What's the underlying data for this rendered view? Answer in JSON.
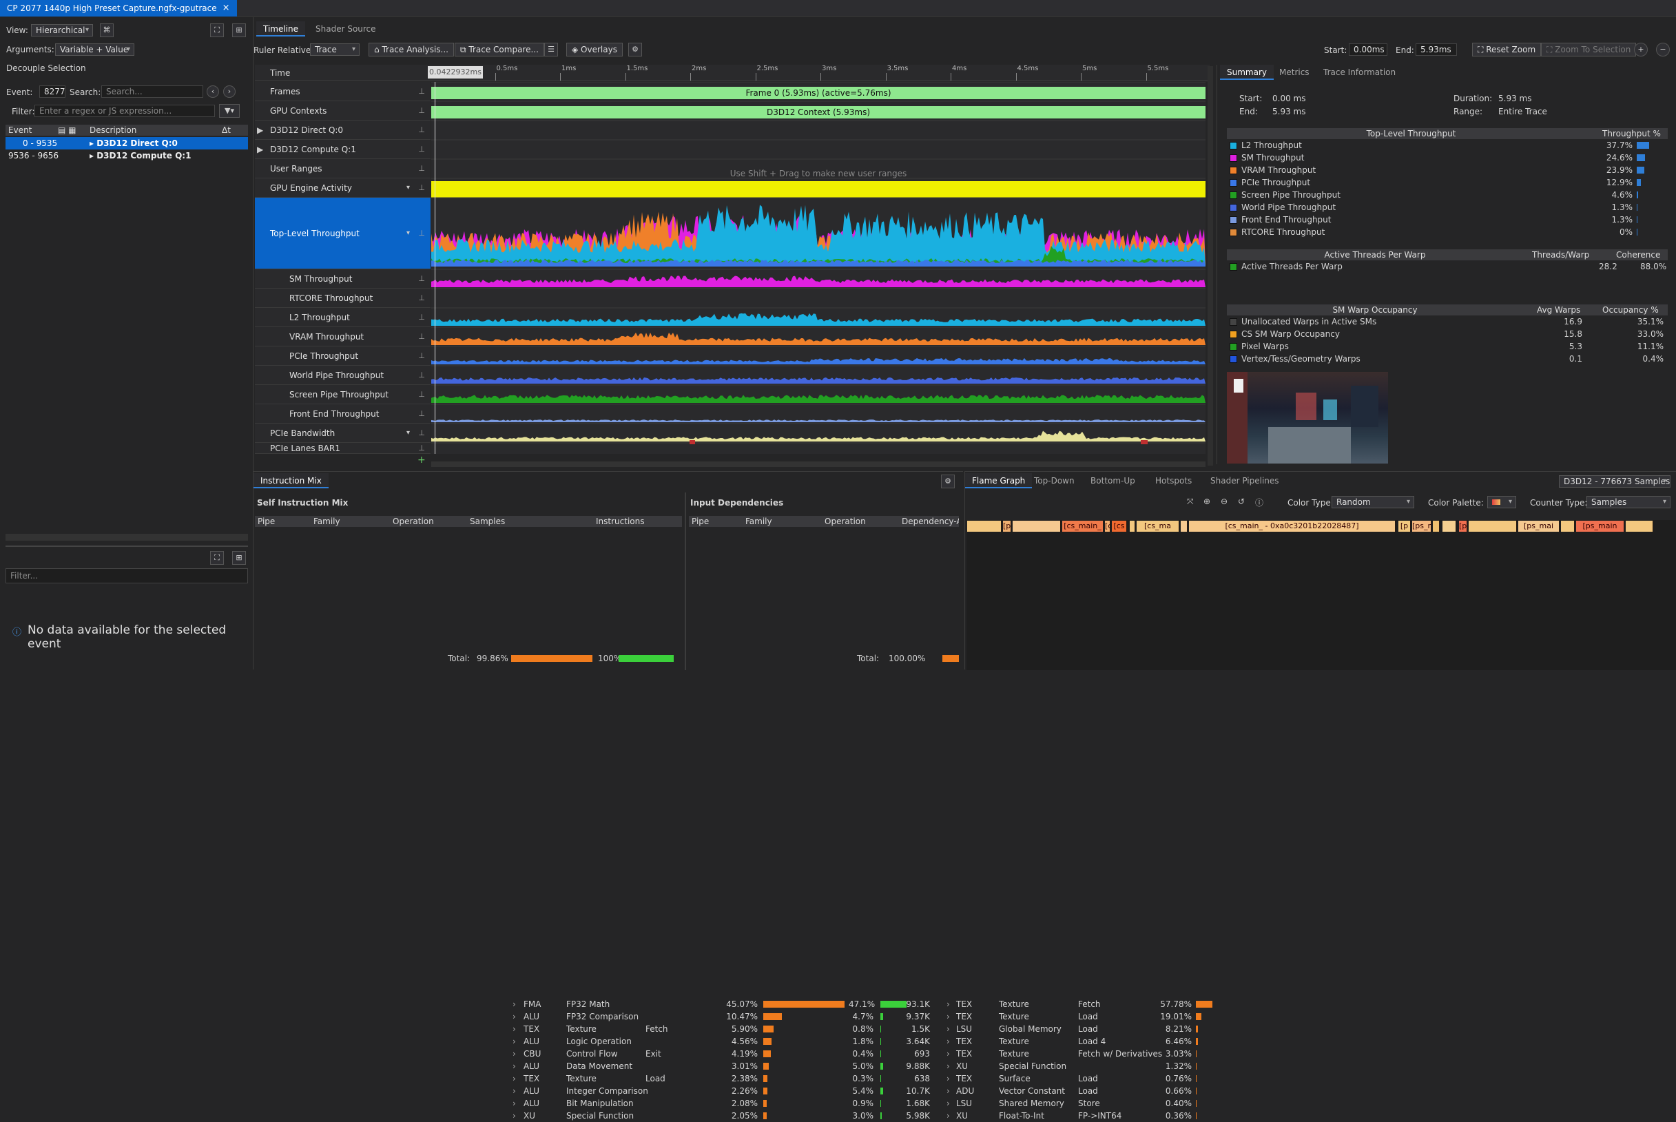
{
  "window": {
    "tab_title": "CP 2077 1440p High Preset Capture.ngfx-gputrace",
    "close": "×"
  },
  "colors": {
    "accent": "#0a64c8",
    "l2": "#1ab0e0",
    "sm": "#e020e0",
    "vram": "#f0802a",
    "pcie": "#3a78e8",
    "screen": "#22a022",
    "world": "#4466dd",
    "frontend": "#7a9adf",
    "rtcore": "#e08a3a",
    "frames": "#8ee88e",
    "activity": "#f0f000",
    "pcie_bw": "#e6e29a"
  },
  "left": {
    "view_label": "View:",
    "view_value": "Hierarchical",
    "args_label": "Arguments:",
    "args_value": "Variable + Value",
    "decouple": "Decouple Selection",
    "event_label": "Event:",
    "event_value": "8277",
    "search_label": "Search:",
    "search_placeholder": "Search...",
    "filter_label": "Filter:",
    "filter_placeholder": "Enter a regex or JS expression...",
    "cols": {
      "event": "Event",
      "desc": "Description",
      "dt": "Δt"
    },
    "rows": [
      {
        "range": "0 - 9535",
        "desc": "D3D12 Direct Q:0"
      },
      {
        "range": "9536 - 9656",
        "desc": "D3D12 Compute Q:1"
      }
    ],
    "filter2_placeholder": "Filter...",
    "nodata": "No data available for the selected event"
  },
  "timeline": {
    "tabs": [
      "Timeline",
      "Shader Source"
    ],
    "ruler_label": "Ruler Relative:",
    "ruler_value": "Trace",
    "trace_analysis": "Trace Analysis...",
    "trace_compare": "Trace Compare...",
    "overlays": "Overlays",
    "start_label": "Start:",
    "start_value": "0.00ms",
    "end_label": "End:",
    "end_value": "5.93ms",
    "reset_zoom": "Reset Zoom",
    "zoom_sel": "Zoom To Selection",
    "time_label": "Time",
    "cursor": "0.0422932ms",
    "ticks": [
      "0.5ms",
      "1ms",
      "1.5ms",
      "2ms",
      "2.5ms",
      "3ms",
      "3.5ms",
      "4ms",
      "4.5ms",
      "5ms",
      "5.5ms"
    ],
    "lanes": [
      "Frames",
      "GPU Contexts",
      "D3D12 Direct Q:0",
      "D3D12 Compute Q:1",
      "User Ranges",
      "GPU Engine Activity",
      "Top-Level Throughput",
      "SM Throughput",
      "RTCORE Throughput",
      "L2 Throughput",
      "VRAM Throughput",
      "PCIe Throughput",
      "World Pipe Throughput",
      "Screen Pipe Throughput",
      "Front End Throughput",
      "PCIe Bandwidth",
      "PCIe Lanes BAR1"
    ],
    "frame_bar": "Frame 0 (5.93ms) (active=5.76ms)",
    "context_bar": "D3D12 Context (5.93ms)",
    "user_hint": "Use Shift + Drag to make new user ranges"
  },
  "summary": {
    "tabs": [
      "Summary",
      "Metrics",
      "Trace Information"
    ],
    "start_l": "Start:",
    "start_v": "0.00 ms",
    "end_l": "End:",
    "end_v": "5.93 ms",
    "dur_l": "Duration:",
    "dur_v": "5.93 ms",
    "range_l": "Range:",
    "range_v": "Entire Trace",
    "tlt": {
      "h1": "Top-Level Throughput",
      "h2": "Throughput %",
      "rows": [
        {
          "n": "L2 Throughput",
          "v": "37.7%",
          "p": 37.7,
          "c": "#1ab0e0"
        },
        {
          "n": "SM Throughput",
          "v": "24.6%",
          "p": 24.6,
          "c": "#e020e0"
        },
        {
          "n": "VRAM Throughput",
          "v": "23.9%",
          "p": 23.9,
          "c": "#f0802a"
        },
        {
          "n": "PCIe Throughput",
          "v": "12.9%",
          "p": 12.9,
          "c": "#3a78e8"
        },
        {
          "n": "Screen Pipe Throughput",
          "v": "4.6%",
          "p": 4.6,
          "c": "#22a022"
        },
        {
          "n": "World Pipe Throughput",
          "v": "1.3%",
          "p": 1.3,
          "c": "#4466dd"
        },
        {
          "n": "Front End Throughput",
          "v": "1.3%",
          "p": 1.3,
          "c": "#7a9adf"
        },
        {
          "n": "RTCORE Throughput",
          "v": "0%",
          "p": 0,
          "c": "#e08a3a"
        }
      ]
    },
    "atw": {
      "h1": "Active Threads Per Warp",
      "h2": "Threads/Warp",
      "h3": "Coherence",
      "rows": [
        {
          "n": "Active Threads Per Warp",
          "a": "28.2",
          "b": "88.0%",
          "c": "#22a022"
        }
      ]
    },
    "occ": {
      "h1": "SM Warp Occupancy",
      "h2": "Avg Warps",
      "h3": "Occupancy %",
      "rows": [
        {
          "n": "Unallocated Warps in Active SMs",
          "a": "16.9",
          "b": "35.1%",
          "c": "#444"
        },
        {
          "n": "CS SM Warp Occupancy",
          "a": "15.8",
          "b": "33.0%",
          "c": "#f0a020"
        },
        {
          "n": "Pixel Warps",
          "a": "5.3",
          "b": "11.1%",
          "c": "#22a022"
        },
        {
          "n": "Vertex/Tess/Geometry Warps",
          "a": "0.1",
          "b": "0.4%",
          "c": "#2255dd"
        }
      ]
    }
  },
  "imix": {
    "tab": "Instruction Mix",
    "self_title": "Self Instruction Mix",
    "cols": [
      "Pipe",
      "Family",
      "Operation",
      "Samples",
      "Instructions"
    ],
    "rows": [
      {
        "pipe": "FMA",
        "fam": "FP32 Math",
        "op": "",
        "s": "45.07%",
        "sp": 45.07,
        "i": "47.1%",
        "ic": "93.1K",
        "ip": 47.1
      },
      {
        "pipe": "ALU",
        "fam": "FP32 Comparison",
        "op": "",
        "s": "10.47%",
        "sp": 10.47,
        "i": "4.7%",
        "ic": "9.37K",
        "ip": 4.7
      },
      {
        "pipe": "TEX",
        "fam": "Texture",
        "op": "Fetch",
        "s": "5.90%",
        "sp": 5.9,
        "i": "0.8%",
        "ic": "1.5K",
        "ip": 0.8
      },
      {
        "pipe": "ALU",
        "fam": "Logic Operation",
        "op": "",
        "s": "4.56%",
        "sp": 4.56,
        "i": "1.8%",
        "ic": "3.64K",
        "ip": 1.8
      },
      {
        "pipe": "CBU",
        "fam": "Control Flow",
        "op": "Exit",
        "s": "4.19%",
        "sp": 4.19,
        "i": "0.4%",
        "ic": "693",
        "ip": 0.4
      },
      {
        "pipe": "ALU",
        "fam": "Data Movement",
        "op": "",
        "s": "3.01%",
        "sp": 3.01,
        "i": "5.0%",
        "ic": "9.88K",
        "ip": 5.0
      },
      {
        "pipe": "TEX",
        "fam": "Texture",
        "op": "Load",
        "s": "2.38%",
        "sp": 2.38,
        "i": "0.3%",
        "ic": "638",
        "ip": 0.3
      },
      {
        "pipe": "ALU",
        "fam": "Integer Comparison",
        "op": "",
        "s": "2.26%",
        "sp": 2.26,
        "i": "5.4%",
        "ic": "10.7K",
        "ip": 5.4
      },
      {
        "pipe": "ALU",
        "fam": "Bit Manipulation",
        "op": "",
        "s": "2.08%",
        "sp": 2.08,
        "i": "0.9%",
        "ic": "1.68K",
        "ip": 0.9
      },
      {
        "pipe": "XU",
        "fam": "Special Function",
        "op": "",
        "s": "2.05%",
        "sp": 2.05,
        "i": "3.0%",
        "ic": "5.98K",
        "ip": 3.0
      }
    ],
    "total_l": "Total:",
    "total_s": "99.86%",
    "total_i": "100%",
    "dep_title": "Input Dependencies",
    "dcols": [
      "Pipe",
      "Family",
      "Operation",
      "Dependency-Att"
    ],
    "drows": [
      {
        "pipe": "TEX",
        "fam": "Texture",
        "op": "Fetch",
        "v": "57.78%",
        "p": 57.78
      },
      {
        "pipe": "TEX",
        "fam": "Texture",
        "op": "Load",
        "v": "19.01%",
        "p": 19.01
      },
      {
        "pipe": "LSU",
        "fam": "Global Memory",
        "op": "Load",
        "v": "8.21%",
        "p": 8.21
      },
      {
        "pipe": "TEX",
        "fam": "Texture",
        "op": "Load 4",
        "v": "6.46%",
        "p": 6.46
      },
      {
        "pipe": "TEX",
        "fam": "Texture",
        "op": "Fetch w/ Derivatives",
        "v": "3.03%",
        "p": 3.03
      },
      {
        "pipe": "XU",
        "fam": "Special Function",
        "op": "",
        "v": "1.32%",
        "p": 1.32
      },
      {
        "pipe": "TEX",
        "fam": "Surface",
        "op": "Load",
        "v": "0.76%",
        "p": 0.76
      },
      {
        "pipe": "ADU",
        "fam": "Vector Constant",
        "op": "Load",
        "v": "0.66%",
        "p": 0.66
      },
      {
        "pipe": "LSU",
        "fam": "Shared Memory",
        "op": "Store",
        "v": "0.40%",
        "p": 0.4
      },
      {
        "pipe": "XU",
        "fam": "Float-To-Int",
        "op": "FP->INT64",
        "v": "0.36%",
        "p": 0.36
      }
    ],
    "dtotal_l": "Total:",
    "dtotal": "100.00%"
  },
  "flame": {
    "tabs": [
      "Flame Graph",
      "Top-Down",
      "Bottom-Up",
      "Hotspots",
      "Shader Pipelines"
    ],
    "samples": "D3D12 - 776673 Samples",
    "color_type_l": "Color Type:",
    "color_type_v": "Random",
    "palette_l": "Color Palette:",
    "counter_l": "Counter Type:",
    "counter_v": "Samples",
    "main_label": "[cs_main_ - 0xa0c3201b22028487]",
    "blocks": [
      "[p",
      "[cs_main_",
      "[cs",
      "[cs_ma",
      "[p",
      "[ps_ma",
      "[ps_mai",
      "[ps_main"
    ]
  }
}
